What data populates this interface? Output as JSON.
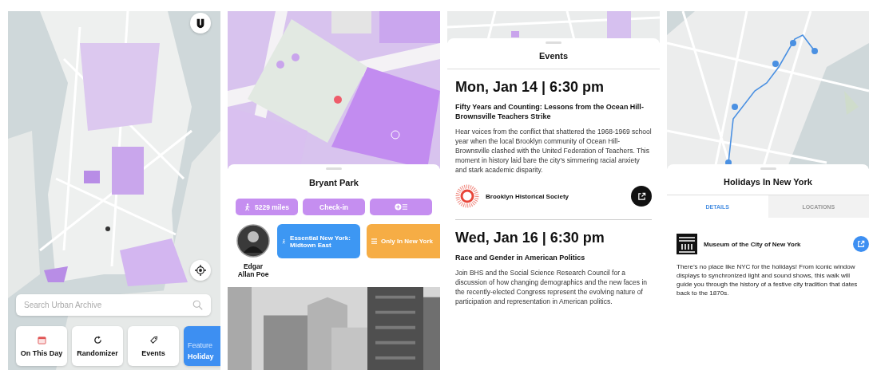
{
  "home": {
    "search": {
      "placeholder": "Search Urban Archive"
    },
    "shortcuts": [
      {
        "kind": "calendar",
        "label": "On This Day"
      },
      {
        "kind": "refresh",
        "label": "Randomizer"
      },
      {
        "kind": "tag",
        "label": "Events"
      },
      {
        "kind": "featured",
        "label": "Feature",
        "sublabel": "Holiday"
      }
    ]
  },
  "place": {
    "title": "Bryant Park",
    "actions": [
      {
        "kind": "distance",
        "label": "5229 miles"
      },
      {
        "kind": "text",
        "label": "Check-in"
      },
      {
        "kind": "add-list"
      }
    ],
    "related": [
      {
        "kind": "person",
        "label": "Edgar Allan Poe"
      },
      {
        "kind": "walk",
        "label": "Essential New York: Midtown East",
        "color": "#3d97f3"
      },
      {
        "kind": "list",
        "label": "Only In New York",
        "color": "#f6ad45"
      }
    ]
  },
  "events": {
    "title": "Events",
    "items": [
      {
        "date": "Mon, Jan 14 | 6:30 pm",
        "title": "Fifty Years and Counting: Lessons from the Ocean Hill-Brownsville Teachers Strike",
        "description": "Hear voices from the conflict that shattered the 1968-1969 school year when the local Brooklyn community of Ocean Hill-Brownsville clashed with the United Federation of Teachers. This moment in history laid bare the city’s simmering racial anxiety and stark academic disparity.",
        "organizer": "Brooklyn Historical Society"
      },
      {
        "date": "Wed, Jan 16 | 6:30 pm",
        "title": "Race and Gender in American Politics",
        "description": "Join BHS and the Social Science Research Council for a discussion of how changing demographics and the new faces in the recently-elected Congress represent the evolving nature of participation and representation in American politics."
      }
    ]
  },
  "walk": {
    "title": "Holidays In New York",
    "tabs": [
      {
        "label": "DETAILS",
        "selected": true
      },
      {
        "label": "LOCATIONS",
        "selected": false
      }
    ],
    "organizer": "Museum of the City of New York",
    "description": "There’s no place like NYC for the holidays! From iconic window displays to synchronized light and sound shows, this walk will guide you through the history of a festive city tradition that dates back to the 1870s."
  }
}
